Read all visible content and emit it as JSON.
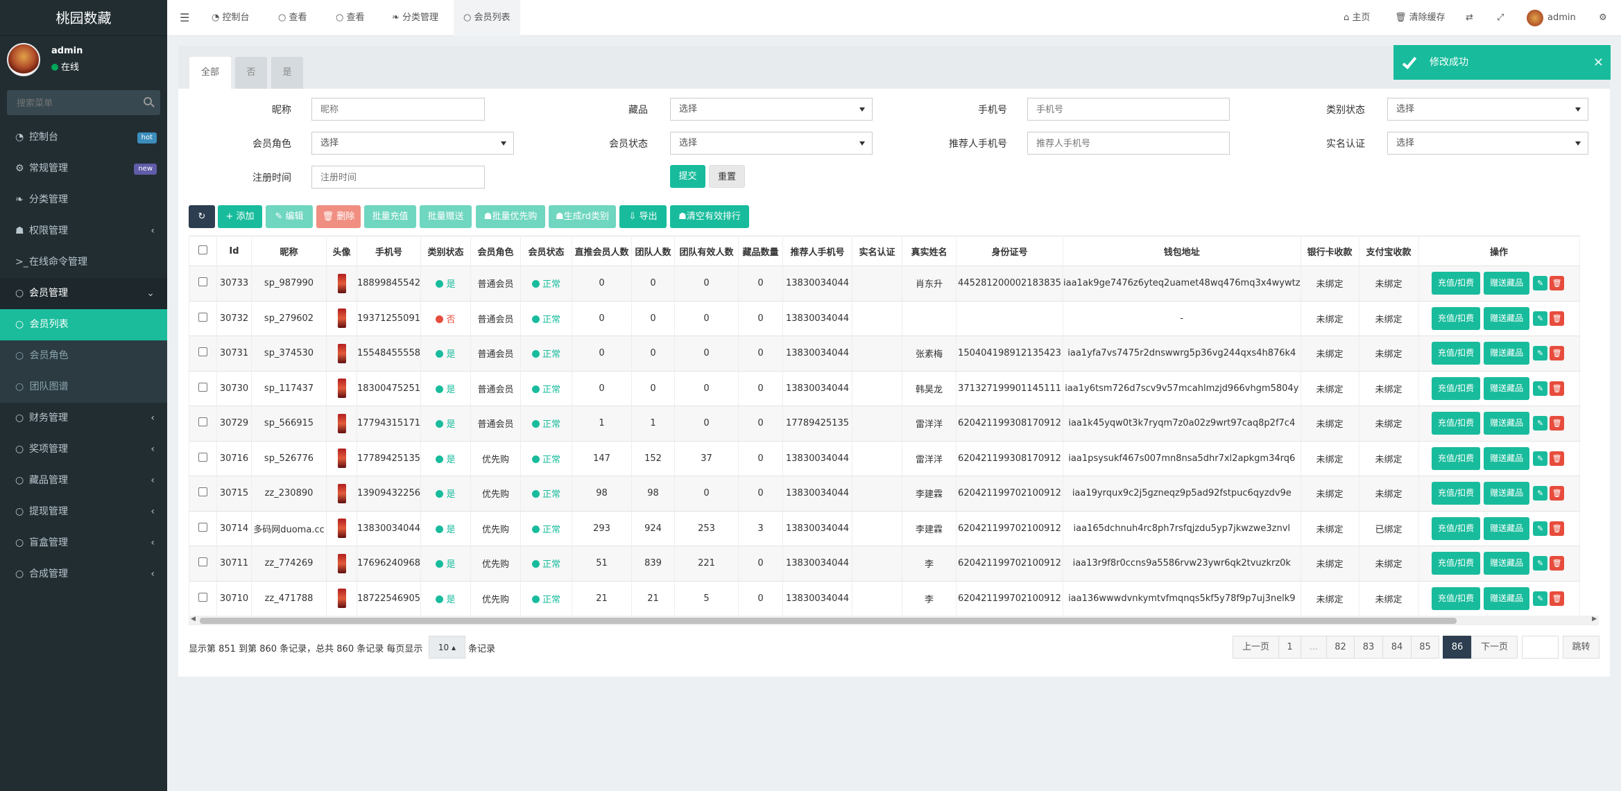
{
  "app": {
    "logo": "桃园数藏"
  },
  "user": {
    "name": "admin",
    "status": "在线"
  },
  "search": {
    "placeholder": "搜索菜单"
  },
  "sidebar": [
    {
      "label": "控制台",
      "icon": "dashboard-icon",
      "badge": "hot",
      "badge_color": "#3c8dbc"
    },
    {
      "label": "常规管理",
      "icon": "cogs-icon",
      "badge": "new",
      "badge_color": "#605ca8"
    },
    {
      "label": "分类管理",
      "icon": "leaf-icon"
    },
    {
      "label": "权限管理",
      "icon": "group-icon",
      "arrow": "‹"
    },
    {
      "label": "在线命令管理",
      "icon": "terminal-icon"
    },
    {
      "label": "会员管理",
      "icon": "circle-icon",
      "arrow": "⌄"
    }
  ],
  "sidebar_sub": [
    {
      "label": "会员列表"
    },
    {
      "label": "会员角色"
    },
    {
      "label": "团队图谱"
    }
  ],
  "sidebar_rest": [
    {
      "label": "财务管理"
    },
    {
      "label": "奖项管理"
    },
    {
      "label": "藏品管理"
    },
    {
      "label": "提现管理"
    },
    {
      "label": "盲盒管理"
    },
    {
      "label": "合成管理"
    }
  ],
  "topbar": {
    "tabs": [
      "控制台",
      "查看",
      "查看",
      "分类管理",
      "会员列表"
    ],
    "right": [
      "主页",
      "清除缓存",
      "admin"
    ]
  },
  "toast": {
    "text": "修改成功"
  },
  "filter_tabs": [
    "全部",
    "否",
    "是"
  ],
  "form": {
    "nickname": {
      "label": "昵称",
      "placeholder": "昵称"
    },
    "collection": {
      "label": "藏品",
      "value": "选择"
    },
    "phone": {
      "label": "手机号",
      "placeholder": "手机号"
    },
    "category_status": {
      "label": "类别状态",
      "value": "选择"
    },
    "role": {
      "label": "会员角色",
      "value": "选择"
    },
    "member_status": {
      "label": "会员状态",
      "value": "选择"
    },
    "ref_phone": {
      "label": "推荐人手机号",
      "placeholder": "推荐人手机号"
    },
    "realname": {
      "label": "实名认证",
      "value": "选择"
    },
    "regtime": {
      "label": "注册时间",
      "placeholder": "注册时间"
    },
    "submit": "提交",
    "reset": "重置"
  },
  "toolbar": {
    "add": "添加",
    "edit": "编辑",
    "del": "删除",
    "batch_recharge": "批量充值",
    "batch_gift": "批量赠送",
    "batch_priority": "批量优先购",
    "gen_type": "生成rd类别",
    "export": "导出",
    "clear_rank": "清空有效排行"
  },
  "table": {
    "headers": [
      "Id",
      "昵称",
      "头像",
      "手机号",
      "类别状态",
      "会员角色",
      "会员状态",
      "直推会员人数",
      "团队人数",
      "团队有效人数",
      "藏品数量",
      "推荐人手机号",
      "实名认证",
      "真实姓名",
      "身份证号",
      "钱包地址",
      "银行卡收款",
      "支付宝收款",
      "操作"
    ],
    "op_labels": {
      "recharge": "充值/扣费",
      "gift": "赠送藏品"
    },
    "rows": [
      {
        "id": "30733",
        "nick": "sp_987990",
        "phone": "18899845542",
        "cat": "是",
        "cat_ok": true,
        "role": "普通会员",
        "status": "正常",
        "direct": "0",
        "team": "0",
        "valid": "0",
        "count": "0",
        "ref": "13830034044",
        "real": "",
        "name": "肖东升",
        "idcard": "445281200002183835",
        "wallet": "iaa1ak9ge7476z6yteq2uamet48wq476mq3x4wywtz",
        "bank": "未绑定",
        "ali": "未绑定"
      },
      {
        "id": "30732",
        "nick": "sp_279602",
        "phone": "19371255091",
        "cat": "否",
        "cat_ok": false,
        "role": "普通会员",
        "status": "正常",
        "direct": "0",
        "team": "0",
        "valid": "0",
        "count": "0",
        "ref": "13830034044",
        "real": "",
        "name": "",
        "idcard": "",
        "wallet": "-",
        "bank": "未绑定",
        "ali": "未绑定"
      },
      {
        "id": "30731",
        "nick": "sp_374530",
        "phone": "15548455558",
        "cat": "是",
        "cat_ok": true,
        "role": "普通会员",
        "status": "正常",
        "direct": "0",
        "team": "0",
        "valid": "0",
        "count": "0",
        "ref": "13830034044",
        "real": "",
        "name": "张素梅",
        "idcard": "150404198912135423",
        "wallet": "iaa1yfa7vs7475r2dnswwrg5p36vg244qxs4h876k4",
        "bank": "未绑定",
        "ali": "未绑定"
      },
      {
        "id": "30730",
        "nick": "sp_117437",
        "phone": "18300475251",
        "cat": "是",
        "cat_ok": true,
        "role": "普通会员",
        "status": "正常",
        "direct": "0",
        "team": "0",
        "valid": "0",
        "count": "0",
        "ref": "13830034044",
        "real": "",
        "name": "韩昊龙",
        "idcard": "371327199901145111",
        "wallet": "iaa1y6tsm726d7scv9v57mcahlmzjd966vhgm5804y",
        "bank": "未绑定",
        "ali": "未绑定"
      },
      {
        "id": "30729",
        "nick": "sp_566915",
        "phone": "17794315171",
        "cat": "是",
        "cat_ok": true,
        "role": "普通会员",
        "status": "正常",
        "direct": "1",
        "team": "1",
        "valid": "0",
        "count": "0",
        "ref": "17789425135",
        "real": "",
        "name": "雷洋洋",
        "idcard": "620421199308170912",
        "wallet": "iaa1k45yqw0t3k7ryqm7z0a02z9wrt97caq8p2f7c4",
        "bank": "未绑定",
        "ali": "未绑定"
      },
      {
        "id": "30716",
        "nick": "sp_526776",
        "phone": "17789425135",
        "cat": "是",
        "cat_ok": true,
        "role": "优先购",
        "status": "正常",
        "direct": "147",
        "team": "152",
        "valid": "37",
        "count": "0",
        "ref": "13830034044",
        "real": "",
        "name": "雷洋洋",
        "idcard": "620421199308170912",
        "wallet": "iaa1psysukf467s007mn8nsa5dhr7xl2apkgm34rq6",
        "bank": "未绑定",
        "ali": "未绑定"
      },
      {
        "id": "30715",
        "nick": "zz_230890",
        "phone": "13909432256",
        "cat": "是",
        "cat_ok": true,
        "role": "优先购",
        "status": "正常",
        "direct": "98",
        "team": "98",
        "valid": "0",
        "count": "0",
        "ref": "13830034044",
        "real": "",
        "name": "李建霖",
        "idcard": "620421199702100912",
        "wallet": "iaa19yrqux9c2j5gzneqz9p5ad92fstpuc6qyzdv9e",
        "bank": "未绑定",
        "ali": "未绑定"
      },
      {
        "id": "30714",
        "nick": "多码网duoma.cc",
        "phone": "13830034044",
        "cat": "是",
        "cat_ok": true,
        "role": "优先购",
        "status": "正常",
        "direct": "293",
        "team": "924",
        "valid": "253",
        "count": "3",
        "ref": "13830034044",
        "real": "",
        "name": "李建霖",
        "idcard": "620421199702100912",
        "wallet": "iaa165dchnuh4rc8ph7rsfqjzdu5yp7jkwzwe3znvl",
        "bank": "未绑定",
        "ali": "已绑定"
      },
      {
        "id": "30711",
        "nick": "zz_774269",
        "phone": "17696240968",
        "cat": "是",
        "cat_ok": true,
        "role": "优先购",
        "status": "正常",
        "direct": "51",
        "team": "839",
        "valid": "221",
        "count": "0",
        "ref": "13830034044",
        "real": "",
        "name": "李",
        "idcard": "620421199702100912",
        "wallet": "iaa13r9f8r0ccns9a5586rvw23ywr6qk2tvuzkrz0k",
        "bank": "未绑定",
        "ali": "未绑定"
      },
      {
        "id": "30710",
        "nick": "zz_471788",
        "phone": "18722546905",
        "cat": "是",
        "cat_ok": true,
        "role": "优先购",
        "status": "正常",
        "direct": "21",
        "team": "21",
        "valid": "5",
        "count": "0",
        "ref": "13830034044",
        "real": "",
        "name": "李",
        "idcard": "620421199702100912",
        "wallet": "iaa136wwwdvnkymtvfmqnqs5kf5y78f9p7uj3nelk9",
        "bank": "未绑定",
        "ali": "未绑定"
      }
    ]
  },
  "footer": {
    "summary": "显示第 851 到第 860 条记录，总共 860 条记录 每页显示",
    "page_size": "10",
    "suffix": "条记录"
  },
  "pagination": {
    "prev": "上一页",
    "items": [
      "1",
      "...",
      "82",
      "83",
      "84",
      "85",
      "86"
    ],
    "active": "86",
    "next": "下一页",
    "jump": "跳转"
  },
  "colors": {
    "accent": "#18bc9c",
    "sidebar": "#222d32",
    "dark": "#2c3e50",
    "red": "#e74c3c"
  }
}
